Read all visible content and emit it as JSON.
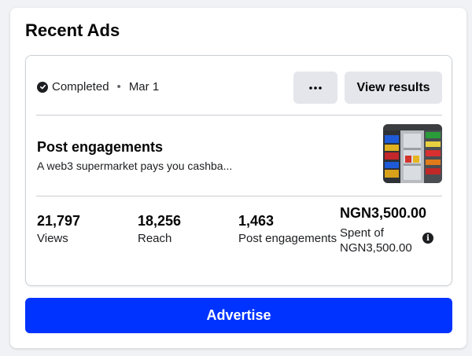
{
  "panel": {
    "title": "Recent Ads"
  },
  "ad": {
    "status": "Completed",
    "date": "Mar 1",
    "more_label": "•••",
    "view_results_label": "View results",
    "headline": "Post engagements",
    "description": "A web3 supermarket pays you cashba...",
    "thumbnail_icon": "supermarket-shelf-image",
    "metrics": [
      {
        "value": "21,797",
        "label": "Views"
      },
      {
        "value": "18,256",
        "label": "Reach"
      },
      {
        "value": "1,463",
        "label": "Post engagements"
      }
    ],
    "spent": {
      "value": "NGN3,500.00",
      "label": "Spent of NGN3,500.00",
      "info_icon": "i"
    }
  },
  "advertise_label": "Advertise",
  "colors": {
    "primary": "#0033ff",
    "button_grey": "#e4e6eb",
    "background": "#f0f2f5"
  }
}
